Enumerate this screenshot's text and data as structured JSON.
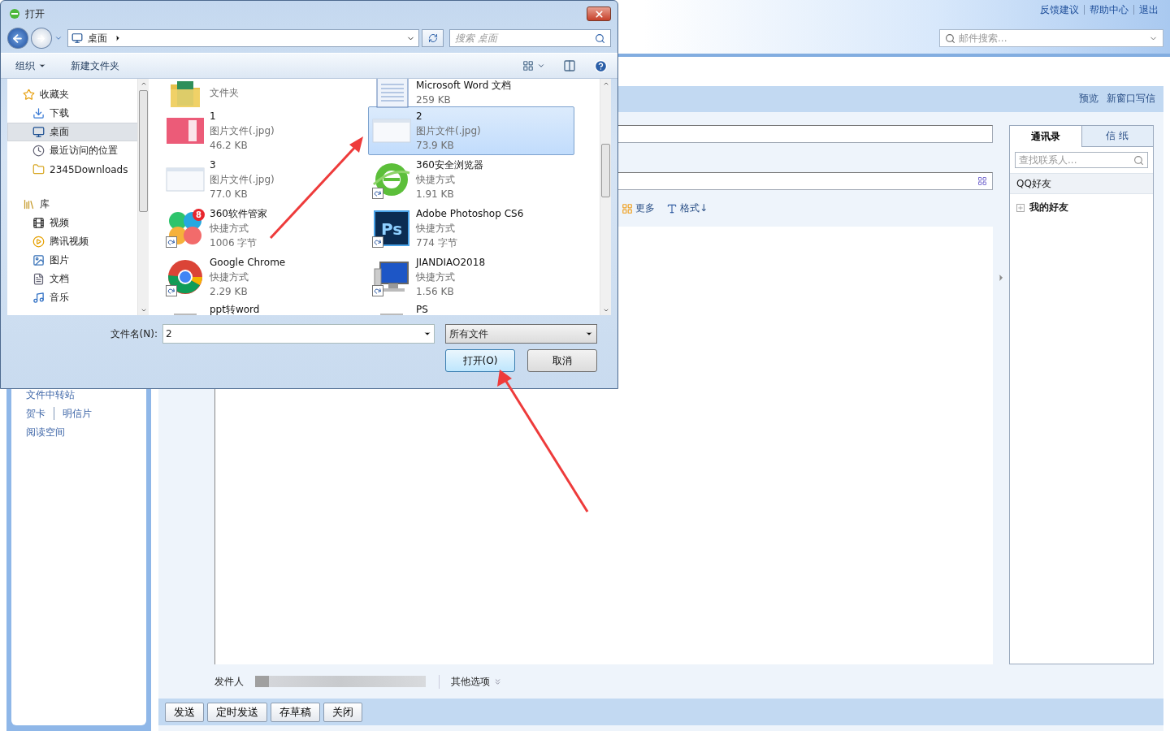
{
  "mail": {
    "header_links": [
      "反馈建议",
      "帮助中心",
      "退出"
    ],
    "search_placeholder": "邮件搜索...",
    "sidebar_links": [
      {
        "items": [
          "文件中转站"
        ]
      },
      {
        "items": [
          "贺卡",
          "明信片"
        ]
      },
      {
        "items": [
          "阅读空间"
        ]
      }
    ],
    "toolbar_links": [
      "预览",
      "新窗口写信"
    ],
    "format_tools": [
      {
        "label": "更多",
        "kind": "more"
      },
      {
        "label": "格式↓",
        "kind": "format"
      }
    ],
    "sender_label": "发件人",
    "other_options": "其他选项",
    "buttons": [
      "发送",
      "定时发送",
      "存草稿",
      "关闭"
    ],
    "contacts": {
      "tabs": [
        {
          "label": "通讯录",
          "selected": true
        },
        {
          "label": "信 纸",
          "selected": false
        }
      ],
      "search_placeholder": "查找联系人...",
      "group": "QQ好友",
      "tree": [
        {
          "label": "我的好友",
          "expanded": false
        }
      ]
    }
  },
  "dialog": {
    "title": "打开",
    "address": "桌面",
    "search_placeholder": "搜索 桌面",
    "toolbar": [
      {
        "label": "组织",
        "menu": true
      },
      {
        "label": "新建文件夹",
        "menu": false
      }
    ],
    "nav": [
      {
        "label": "收藏夹",
        "kind": "star",
        "selected": false,
        "children": [
          {
            "label": "下载",
            "kind": "download",
            "selected": false
          },
          {
            "label": "桌面",
            "kind": "desktop",
            "selected": true
          },
          {
            "label": "最近访问的位置",
            "kind": "recent",
            "selected": false
          },
          {
            "label": "2345Downloads",
            "kind": "folder",
            "selected": false
          }
        ]
      },
      {
        "label": "库",
        "kind": "library",
        "selected": false,
        "children": [
          {
            "label": "视频",
            "kind": "video",
            "selected": false
          },
          {
            "label": "腾讯视频",
            "kind": "play",
            "selected": false
          },
          {
            "label": "图片",
            "kind": "image",
            "selected": false
          },
          {
            "label": "文档",
            "kind": "document",
            "selected": false
          },
          {
            "label": "音乐",
            "kind": "music",
            "selected": false
          }
        ]
      }
    ],
    "files": [
      {
        "kind": "folder",
        "details": [
          "文件夹"
        ],
        "selected": false,
        "shortcut": false
      },
      {
        "kind": "document",
        "name": "Microsoft Word 文档",
        "details": [
          "259 KB"
        ],
        "selected": false,
        "shortcut": false
      },
      {
        "kind": "pink-image",
        "name": "1",
        "details": [
          "图片文件(.jpg)",
          "46.2 KB"
        ],
        "selected": false,
        "shortcut": false
      },
      {
        "kind": "screenshot",
        "name": "2",
        "details": [
          "图片文件(.jpg)",
          "73.9 KB"
        ],
        "selected": true,
        "shortcut": false
      },
      {
        "kind": "screenshot",
        "name": "3",
        "details": [
          "图片文件(.jpg)",
          "77.0 KB"
        ],
        "selected": false,
        "shortcut": false
      },
      {
        "kind": "globe",
        "name": "360安全浏览器",
        "details": [
          "快捷方式",
          "1.91 KB"
        ],
        "selected": false,
        "shortcut": true
      },
      {
        "kind": "petals",
        "name": "360软件管家",
        "badge": "8",
        "details": [
          "快捷方式",
          "1006 字节"
        ],
        "selected": false,
        "shortcut": true
      },
      {
        "kind": "ps",
        "name": "Adobe Photoshop CS6",
        "icon_text": "Ps",
        "details": [
          "快捷方式",
          "774 字节"
        ],
        "selected": false,
        "shortcut": true
      },
      {
        "kind": "chrome",
        "name": "Google Chrome",
        "details": [
          "快捷方式",
          "2.29 KB"
        ],
        "selected": false,
        "shortcut": true
      },
      {
        "kind": "monitor",
        "name": "JIANDIAO2018",
        "details": [
          "快捷方式",
          "1.56 KB"
        ],
        "selected": false,
        "shortcut": true
      },
      {
        "kind": "blank",
        "name": "ppt转word",
        "selected": false,
        "shortcut": false
      },
      {
        "kind": "blank",
        "name": "PS",
        "selected": false,
        "shortcut": false
      }
    ],
    "filename_label": "文件名(N):",
    "filename": "2",
    "filter": "所有文件",
    "buttons": [
      {
        "label": "打开(O)",
        "default": true
      },
      {
        "label": "取消",
        "default": false
      }
    ]
  }
}
